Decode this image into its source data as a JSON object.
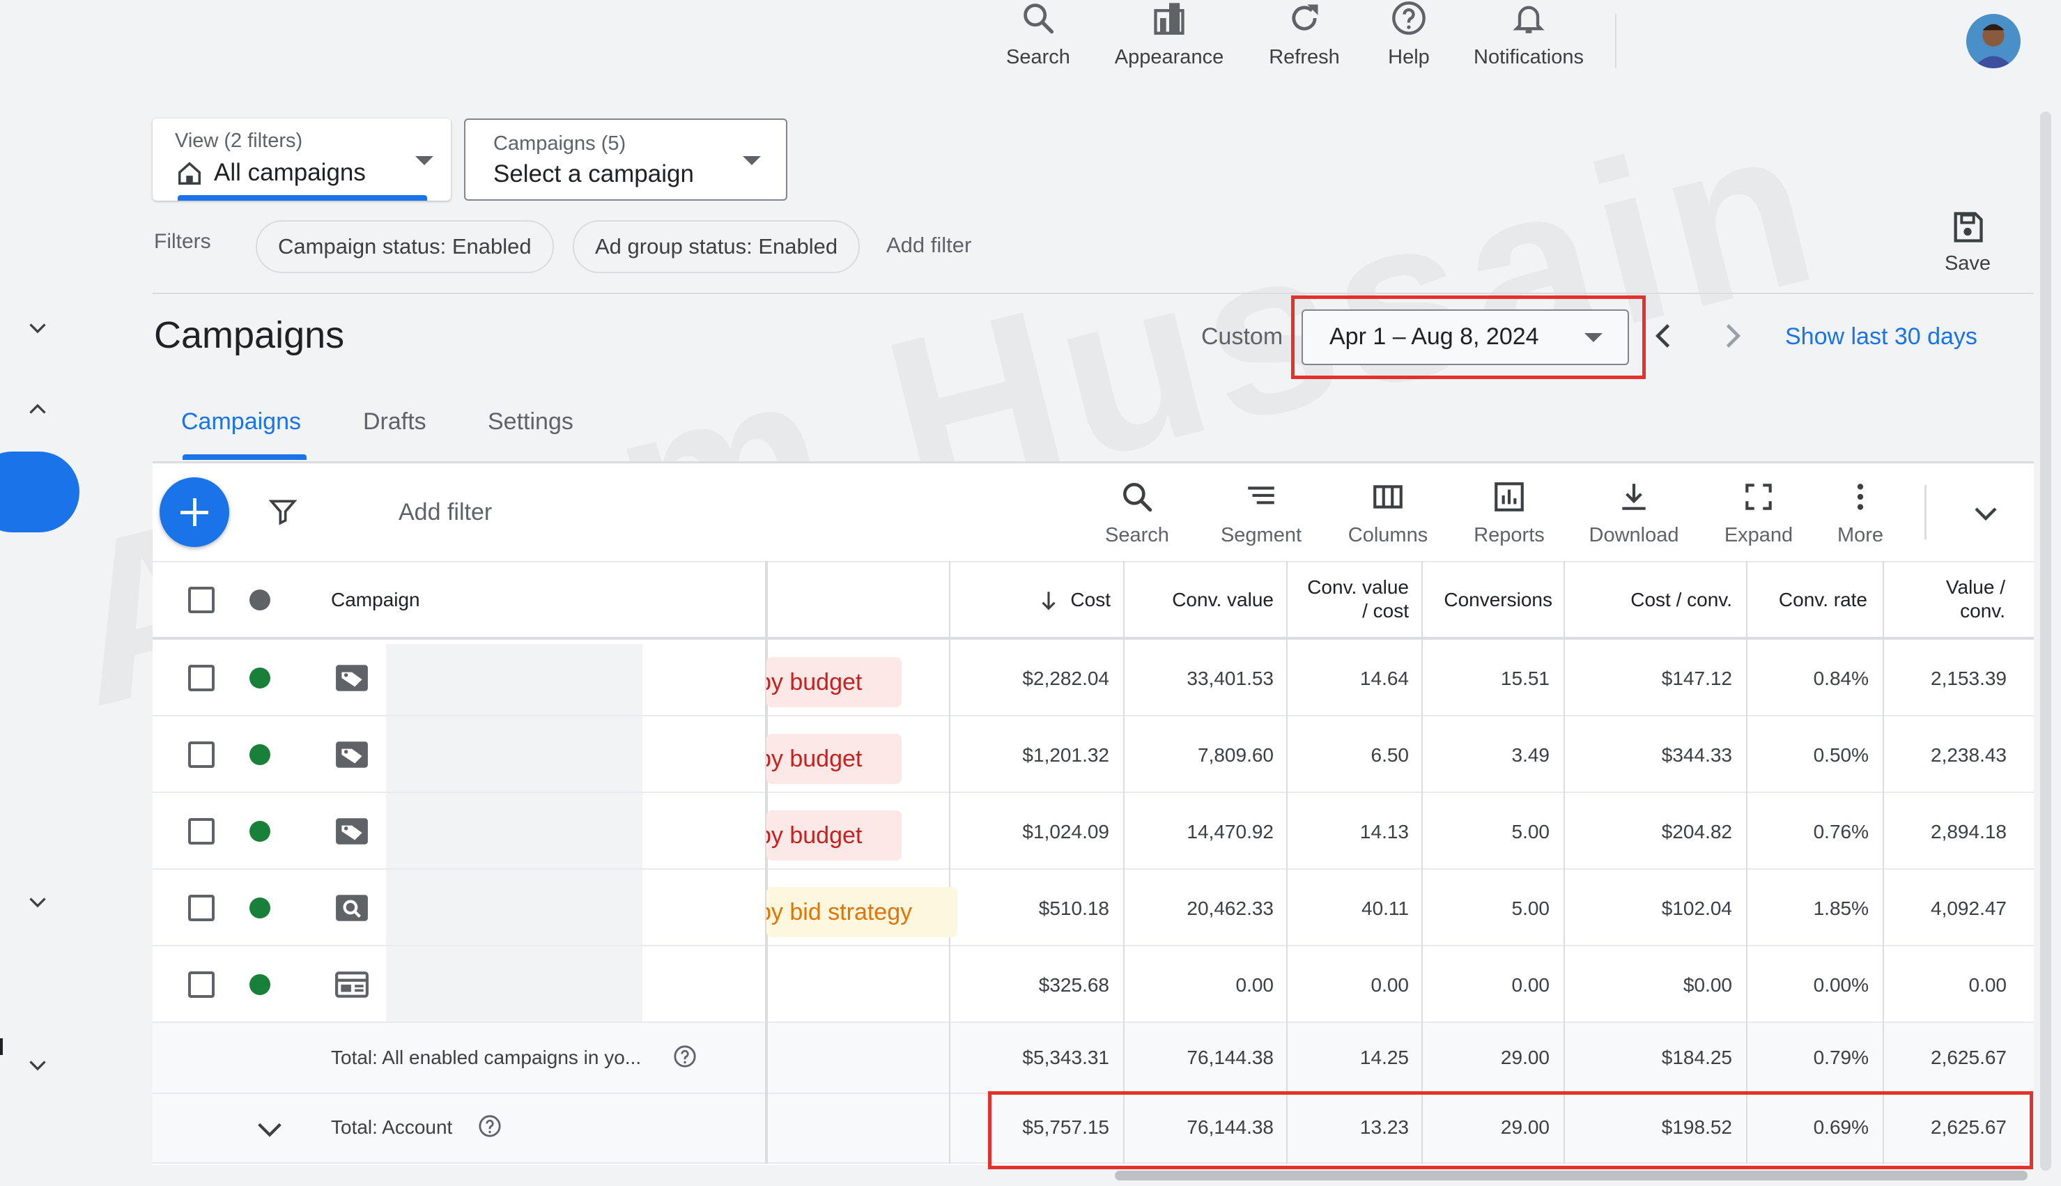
{
  "header": {
    "buttons": [
      {
        "label": "Search",
        "icon": "search-icon"
      },
      {
        "label": "Appearance",
        "icon": "appearance-icon"
      },
      {
        "label": "Refresh",
        "icon": "refresh-icon"
      },
      {
        "label": "Help",
        "icon": "help-icon"
      },
      {
        "label": "Notifications",
        "icon": "bell-icon"
      }
    ]
  },
  "view_selector": {
    "caption": "View (2 filters)",
    "value": "All campaigns"
  },
  "campaign_selector": {
    "caption": "Campaigns (5)",
    "value": "Select a campaign"
  },
  "filters": {
    "label": "Filters",
    "chips": [
      "Campaign status: Enabled",
      "Ad group status: Enabled"
    ],
    "add_filter": "Add filter"
  },
  "save": {
    "label": "Save"
  },
  "page": {
    "title": "Campaigns"
  },
  "date_range": {
    "custom_label": "Custom",
    "value": "Apr 1 – Aug 8, 2024",
    "show_last": "Show last 30 days"
  },
  "tabs": [
    "Campaigns",
    "Drafts",
    "Settings"
  ],
  "toolbar": {
    "add_filter": "Add filter",
    "tools": [
      "Search",
      "Segment",
      "Columns",
      "Reports",
      "Download",
      "Expand",
      "More"
    ]
  },
  "table": {
    "columns": {
      "campaign": "Campaign",
      "cost": "Cost",
      "conv_value": "Conv. value",
      "conv_value_cost_1": "Conv. value",
      "conv_value_cost_2": "/ cost",
      "conversions": "Conversions",
      "cost_conv": "Cost / conv.",
      "conv_rate": "Conv. rate",
      "value_conv_1": "Value /",
      "value_conv_2": "conv."
    },
    "rows": [
      {
        "type": "tag",
        "status": "by budget",
        "status_color": "red",
        "cost": "$2,282.04",
        "conv_value": "33,401.53",
        "conv_value_cost": "14.64",
        "conversions": "15.51",
        "cost_conv": "$147.12",
        "conv_rate": "0.84%",
        "value_conv": "2,153.39"
      },
      {
        "type": "tag",
        "status": "by budget",
        "status_color": "red",
        "cost": "$1,201.32",
        "conv_value": "7,809.60",
        "conv_value_cost": "6.50",
        "conversions": "3.49",
        "cost_conv": "$344.33",
        "conv_rate": "0.50%",
        "value_conv": "2,238.43"
      },
      {
        "type": "tag",
        "status": "by budget",
        "status_color": "red",
        "cost": "$1,024.09",
        "conv_value": "14,470.92",
        "conv_value_cost": "14.13",
        "conversions": "5.00",
        "cost_conv": "$204.82",
        "conv_rate": "0.76%",
        "value_conv": "2,894.18"
      },
      {
        "type": "search",
        "status": "by bid strategy",
        "status_color": "amber",
        "cost": "$510.18",
        "conv_value": "20,462.33",
        "conv_value_cost": "40.11",
        "conversions": "5.00",
        "cost_conv": "$102.04",
        "conv_rate": "1.85%",
        "value_conv": "4,092.47"
      },
      {
        "type": "display",
        "status": "",
        "status_color": "",
        "cost": "$325.68",
        "conv_value": "0.00",
        "conv_value_cost": "0.00",
        "conversions": "0.00",
        "cost_conv": "$0.00",
        "conv_rate": "0.00%",
        "value_conv": "0.00"
      }
    ],
    "totals": [
      {
        "label": "Total: All enabled campaigns in yo...",
        "cost": "$5,343.31",
        "conv_value": "76,144.38",
        "conv_value_cost": "14.25",
        "conversions": "29.00",
        "cost_conv": "$184.25",
        "conv_rate": "0.79%",
        "value_conv": "2,625.67"
      },
      {
        "label": "Total: Account",
        "cost": "$5,757.15",
        "conv_value": "76,144.38",
        "conv_value_cost": "13.23",
        "conversions": "29.00",
        "cost_conv": "$198.52",
        "conv_rate": "0.69%",
        "value_conv": "2,625.67"
      }
    ]
  },
  "watermark": "Azeem Hussain",
  "colors": {
    "accent": "#1a73e8",
    "highlight": "#e5312b",
    "enabled": "#188038"
  }
}
